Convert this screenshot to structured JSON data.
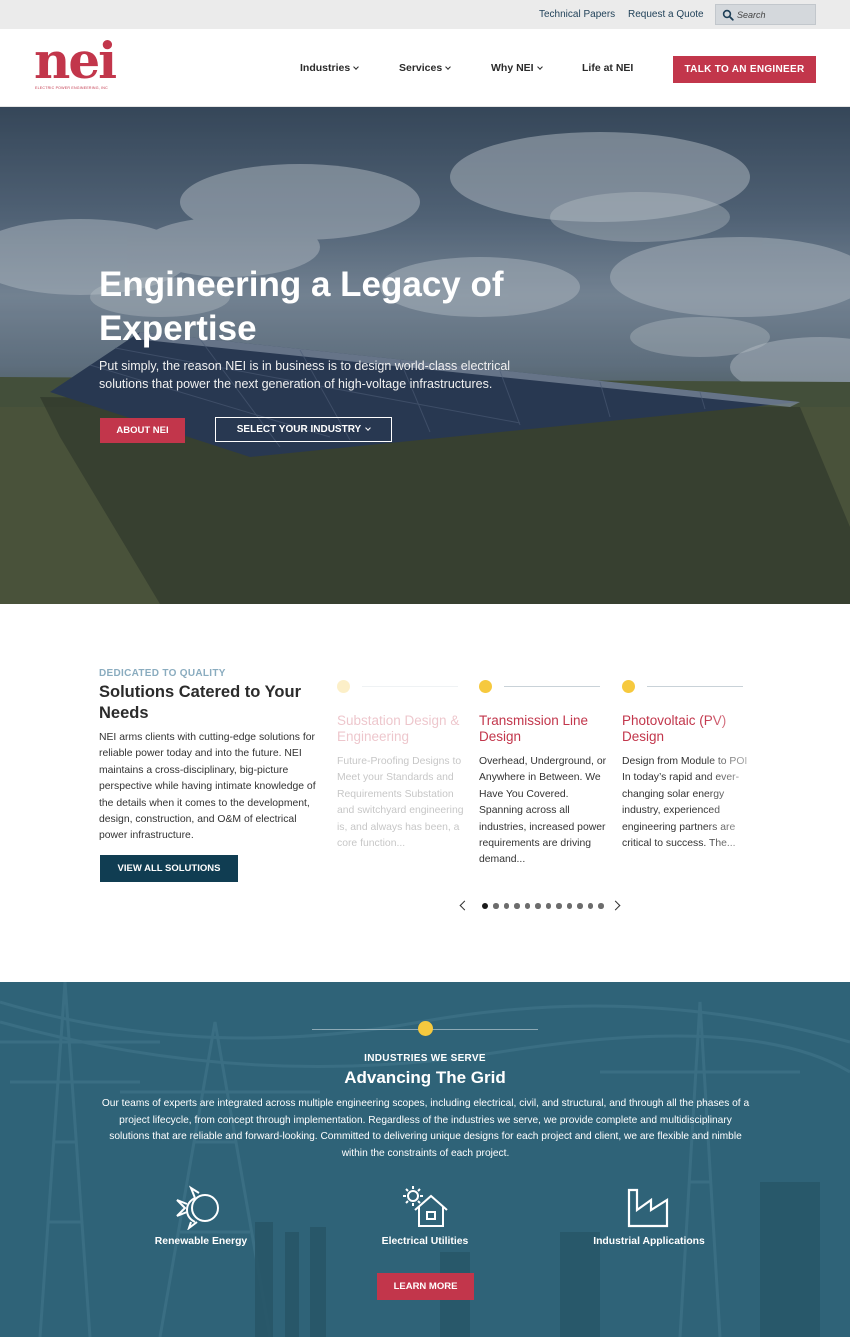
{
  "utility": {
    "links": [
      "Technical Papers",
      "Request a Quote"
    ],
    "search_placeholder": "Search"
  },
  "header": {
    "logo_text": "nei",
    "logo_subtext": "ELECTRIC POWER ENGINEERING, INC",
    "nav": [
      "Industries",
      "Services",
      "Why NEI",
      "Life at NEI"
    ],
    "cta": "TALK TO AN ENGINEER"
  },
  "hero": {
    "title": "Engineering a Legacy of Expertise",
    "subtitle": "Put simply, the reason NEI is in business is to design world-class electrical solutions that power the next generation of high-voltage infrastructures.",
    "primary_button": "ABOUT NEI",
    "secondary_button": "SELECT YOUR INDUSTRY"
  },
  "solutions": {
    "kicker": "DEDICATED TO QUALITY",
    "title": "Solutions Catered to Your Needs",
    "body": "NEI arms clients with cutting-edge solutions for reliable power today and into the future. NEI maintains a cross-disciplinary, big-picture perspective while having intimate knowledge of the details when it comes to the development, design, construction, and O&M of electrical power infrastructure.",
    "button": "VIEW ALL SOLUTIONS",
    "cards": [
      {
        "title": "Substation Design & Engineering",
        "body": "Future-Proofing Designs to Meet your Standards and Requirements Substation and switchyard engineering is, and always has been, a core function..."
      },
      {
        "title": "Transmission Line Design",
        "body": "Overhead, Underground, or Anywhere in Between. We Have You Covered. Spanning across all industries, increased power requirements are driving demand..."
      },
      {
        "title": "Photovoltaic (PV) Design",
        "body": "Design from Module to POI In today’s rapid and ever-changing solar energy industry, experienced engineering partners are critical to success. The..."
      }
    ],
    "carousel": {
      "total_slides": 12,
      "active_slide": 1
    }
  },
  "industries": {
    "kicker": "INDUSTRIES WE SERVE",
    "title": "Advancing The Grid",
    "body": "Our teams of experts are integrated across multiple engineering scopes, including electrical, civil, and structural, and through all the phases of a project lifecycle, from concept through implementation. Regardless of the industries we serve, we provide complete and multidisciplinary solutions that are reliable and forward-looking.  Committed to delivering unique designs for each project and client,  we are flexible and nimble within the constraints of each project.",
    "items": [
      {
        "label": "Renewable Energy",
        "icon": "renewable-energy-icon"
      },
      {
        "label": "Electrical Utilities",
        "icon": "electrical-utilities-icon"
      },
      {
        "label": "Industrial Applications",
        "icon": "factory-icon"
      }
    ],
    "button": "LEARN MORE"
  },
  "colors": {
    "brand_red": "#c2364b",
    "navy": "#103d52",
    "teal": "#2f6378",
    "accent_yellow": "#f6c93e"
  }
}
